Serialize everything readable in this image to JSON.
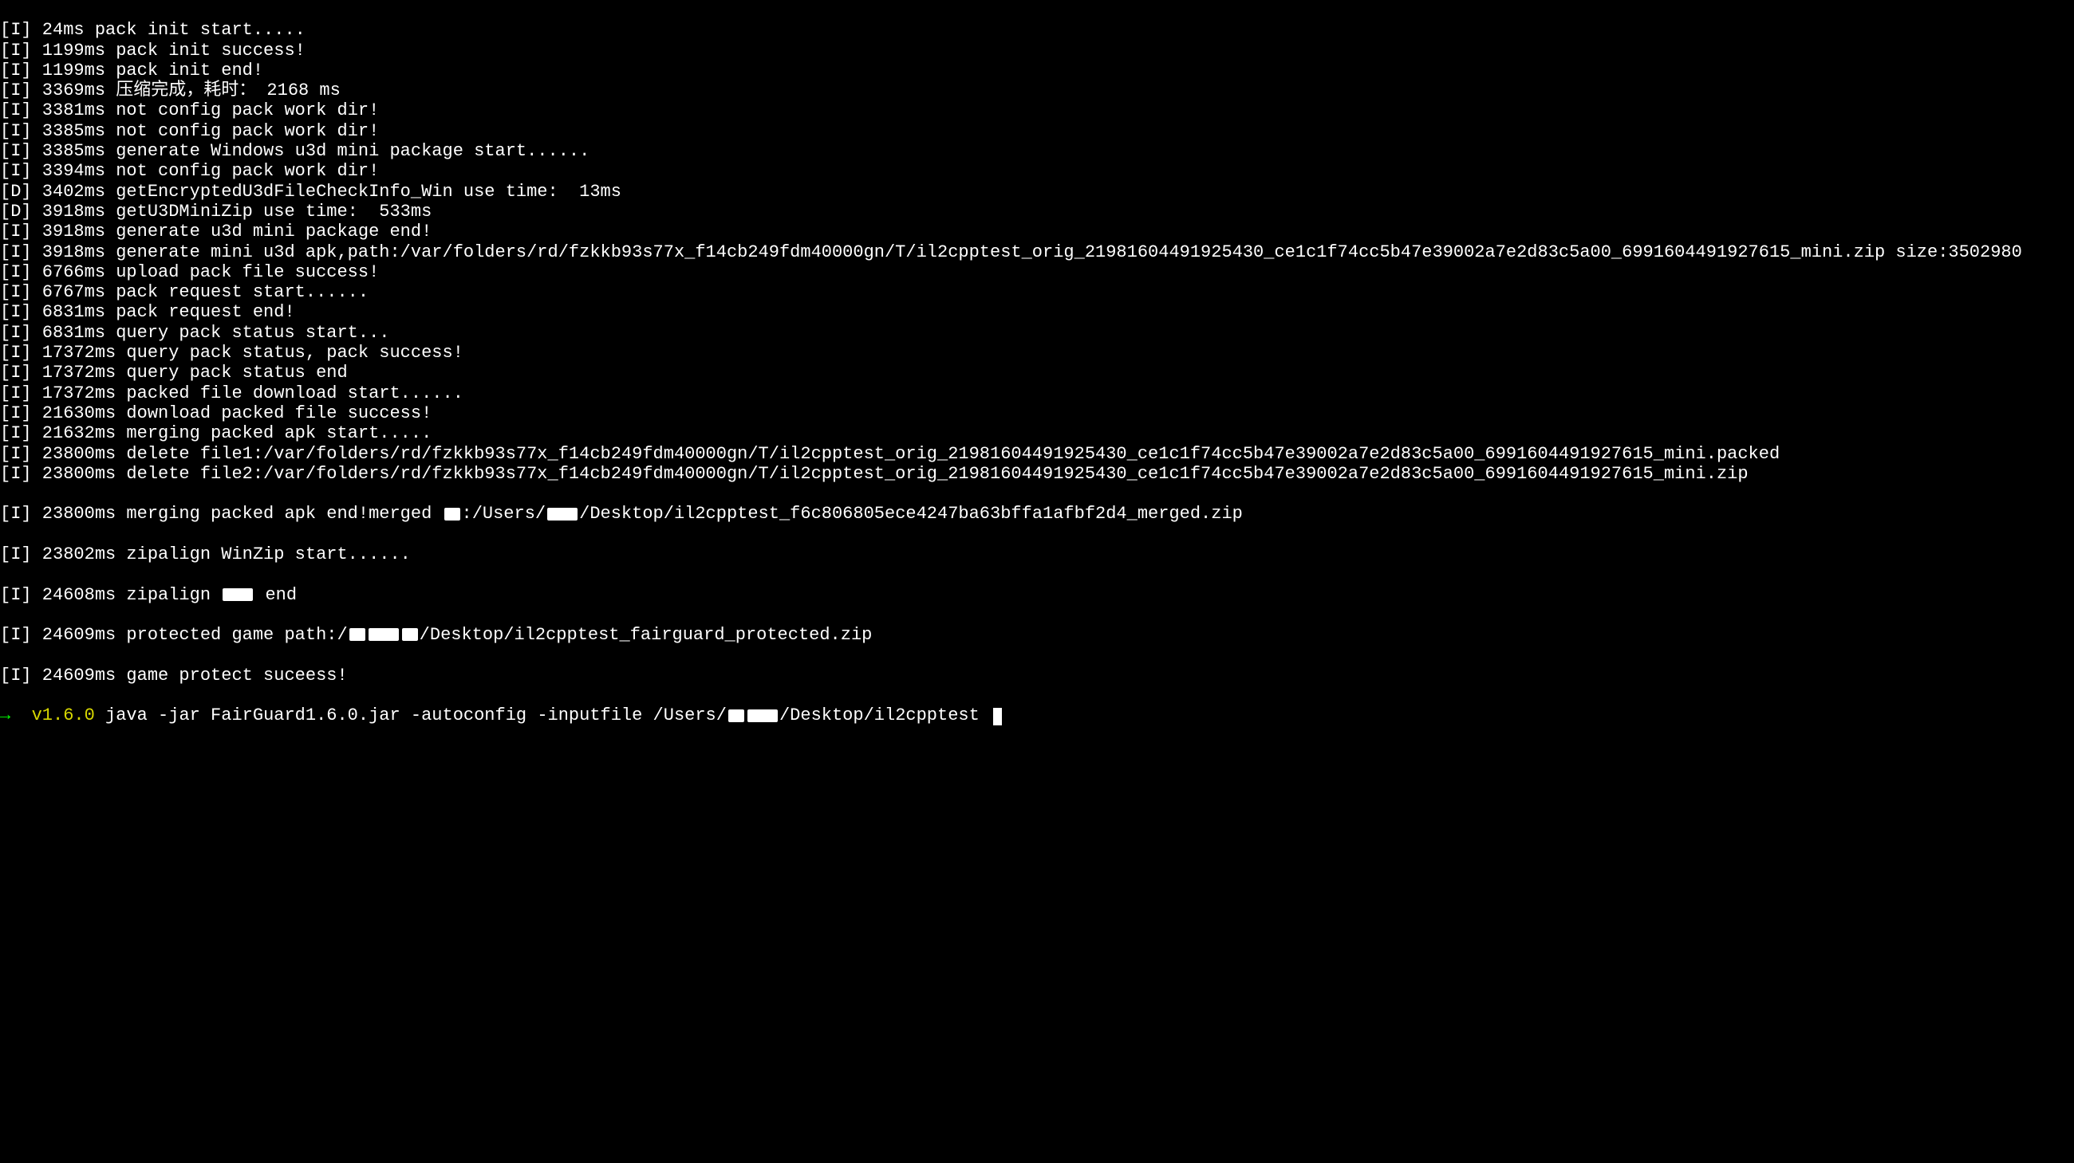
{
  "logs": [
    "[I] 24ms pack init start.....",
    "[I] 1199ms pack init success!",
    "[I] 1199ms pack init end!",
    "[I] 3369ms 压缩完成，耗时： 2168 ms",
    "[I] 3381ms not config pack work dir!",
    "[I] 3385ms not config pack work dir!",
    "[I] 3385ms generate Windows u3d mini package start......",
    "[I] 3394ms not config pack work dir!",
    "[D] 3402ms getEncryptedU3dFileCheckInfo_Win use time:  13ms",
    "[D] 3918ms getU3DMiniZip use time:  533ms",
    "[I] 3918ms generate u3d mini package end!",
    "[I] 3918ms generate mini u3d apk,path:/var/folders/rd/fzkkb93s77x_f14cb249fdm40000gn/T/il2cpptest_orig_21981604491925430_ce1c1f74cc5b47e39002a7e2d83c5a00_6991604491927615_mini.zip size:3502980",
    "[I] 6766ms upload pack file success!",
    "[I] 6767ms pack request start......",
    "[I] 6831ms pack request end!",
    "[I] 6831ms query pack status start...",
    "[I] 17372ms query pack status, pack success!",
    "[I] 17372ms query pack status end",
    "[I] 17372ms packed file download start......",
    "[I] 21630ms download packed file success!",
    "[I] 21632ms merging packed apk start.....",
    "[I] 23800ms delete file1:/var/folders/rd/fzkkb93s77x_f14cb249fdm40000gn/T/il2cpptest_orig_21981604491925430_ce1c1f74cc5b47e39002a7e2d83c5a00_6991604491927615_mini.packed",
    "[I] 23800ms delete file2:/var/folders/rd/fzkkb93s77x_f14cb249fdm40000gn/T/il2cpptest_orig_21981604491925430_ce1c1f74cc5b47e39002a7e2d83c5a00_6991604491927615_mini.zip"
  ],
  "merged_line": {
    "prefix": "[I] 23800ms merging packed apk end!merged ",
    "mid": ":/Users/",
    "suffix": "/Desktop/il2cpptest_f6c806805ece4247ba63bffa1afbf2d4_merged.zip"
  },
  "zipalign_start": "[I] 23802ms zipalign WinZip start......",
  "zipalign_end": {
    "prefix": "[I] 24608ms zipalign ",
    "suffix": " end"
  },
  "protected_path": {
    "prefix": "[I] 24609ms protected game path:/",
    "suffix": "/Desktop/il2cpptest_fairguard_protected.zip"
  },
  "final_log": "[I] 24609ms game protect suceess!",
  "prompt": {
    "arrow": "→",
    "version": "v1.6.0",
    "cmd_pre": "java -jar FairGuard1.6.0.jar -autoconfig -inputfile /Users/",
    "cmd_post": "/Desktop/il2cpptest"
  }
}
